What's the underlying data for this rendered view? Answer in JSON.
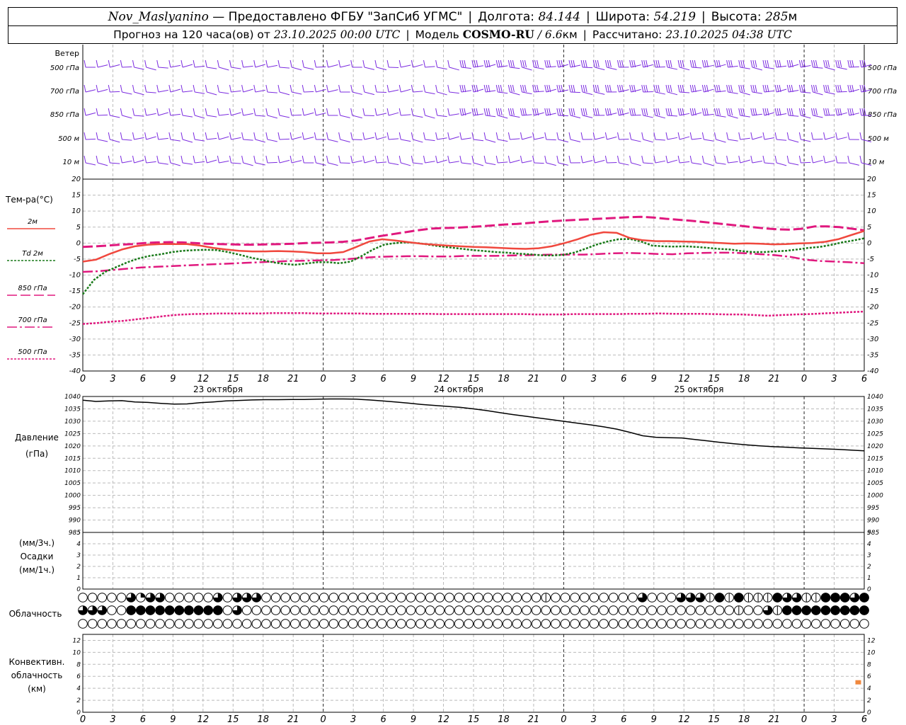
{
  "header": {
    "station": "Nov_Maslyanino",
    "provider": "— Предоставлено ФГБУ \"ЗапСиб УГМС\"",
    "lon_label": "Долгота:",
    "lon": "84.144",
    "lat_label": "Широта:",
    "lat": "54.219",
    "alt_label": "Высота:",
    "alt": "285",
    "alt_unit": "м",
    "forecast_label": "Прогноз на 120 часа(ов) от",
    "forecast_from": "23.10.2025 00:00 UTC",
    "model_label": "Модель",
    "model": "COSMO-RU",
    "model_res": "/ 6.6",
    "model_res_unit": "км",
    "calc_label": "Рассчитано:",
    "calc_time": "23.10.2025 04:38 UTC"
  },
  "chart_data": {
    "x_hours": [
      "0",
      "3",
      "6",
      "9",
      "12",
      "15",
      "18",
      "21",
      "0",
      "3",
      "6",
      "9",
      "12",
      "15",
      "18",
      "21",
      "0",
      "3",
      "6",
      "9",
      "12",
      "15",
      "18",
      "21",
      "0",
      "3",
      "6"
    ],
    "day_labels": [
      {
        "step": 4.5,
        "label": "23 октября"
      },
      {
        "step": 12.5,
        "label": "24 октября"
      },
      {
        "step": 20.5,
        "label": "25 октября"
      }
    ],
    "midnight_steps": [
      0,
      8,
      16,
      24
    ],
    "wind": {
      "panel_label": "Ветер",
      "levels": [
        "500 гПа",
        "700 гПа",
        "850 гПа",
        "500 м",
        "10  м"
      ],
      "color": "#7b2be0"
    },
    "temperature": {
      "panel_label": "Тем-ра(°C)",
      "ylim": [
        -40,
        20
      ],
      "yticks": [
        20,
        15,
        10,
        5,
        0,
        -5,
        -10,
        -15,
        -20,
        -25,
        -30,
        -35,
        -40
      ],
      "series": [
        {
          "name": "2м",
          "color": "#f0483e",
          "dash": "",
          "width": 2.5,
          "values": [
            -5.8,
            -5.2,
            -3.5,
            -2.0,
            -1.0,
            -0.5,
            -0.3,
            -0.3,
            -0.3,
            -0.8,
            -1.5,
            -2.0,
            -2.4,
            -2.6,
            -2.6,
            -2.5,
            -2.6,
            -2.8,
            -3.2,
            -3.2,
            -2.8,
            -1.2,
            0.5,
            1.2,
            0.8,
            0.3,
            -0.2,
            -0.5,
            -0.8,
            -1.0,
            -1.2,
            -1.3,
            -1.5,
            -1.7,
            -1.8,
            -1.6,
            -1.0,
            0.0,
            1.2,
            2.6,
            3.4,
            3.2,
            1.6,
            0.9,
            0.6,
            0.6,
            0.5,
            0.4,
            0.2,
            0.0,
            -0.2,
            -0.1,
            -0.2,
            -0.4,
            -0.3,
            -0.1,
            0.0,
            0.4,
            1.2,
            2.5,
            3.8
          ]
        },
        {
          "name": "Td  2м",
          "color": "#1a7a1a",
          "dash": "3,2",
          "width": 2.5,
          "values": [
            -16.0,
            -11.5,
            -9.0,
            -7.5,
            -6.0,
            -4.8,
            -4.0,
            -3.5,
            -2.8,
            -2.4,
            -2.2,
            -2.1,
            -2.2,
            -2.8,
            -3.6,
            -4.5,
            -5.2,
            -6.0,
            -6.5,
            -6.8,
            -6.4,
            -6.0,
            -6.0,
            -6.3,
            -5.8,
            -4.0,
            -2.0,
            -0.5,
            0.0,
            0.2,
            0.0,
            -0.5,
            -1.0,
            -1.4,
            -1.8,
            -2.2,
            -2.5,
            -2.8,
            -3.0,
            -3.3,
            -3.5,
            -3.8,
            -3.9,
            -3.7,
            -3.0,
            -1.8,
            -0.5,
            0.5,
            1.2,
            1.3,
            0.5,
            -0.8,
            -1.0,
            -1.1,
            -1.0,
            -1.2,
            -1.5,
            -1.8,
            -2.0,
            -2.5,
            -2.8,
            -2.8,
            -2.6,
            -2.4,
            -2.0,
            -1.5,
            -1.2,
            -0.6,
            0.2,
            0.8,
            1.5
          ]
        },
        {
          "name": "850 гПа",
          "color": "#e0187e",
          "dash": "14,5",
          "width": 3,
          "values": [
            -1.2,
            -1.0,
            -0.8,
            -0.5,
            -0.3,
            0.0,
            0.2,
            0.3,
            0.2,
            0.0,
            -0.2,
            -0.3,
            -0.4,
            -0.5,
            -0.5,
            -0.4,
            -0.3,
            -0.2,
            0.0,
            0.1,
            0.2,
            0.4,
            0.8,
            1.5,
            2.2,
            2.8,
            3.4,
            4.0,
            4.5,
            4.7,
            4.8,
            5.0,
            5.2,
            5.5,
            5.8,
            6.0,
            6.3,
            6.6,
            6.9,
            7.1,
            7.3,
            7.5,
            7.7,
            7.9,
            8.1,
            8.2,
            8.0,
            7.6,
            7.3,
            7.0,
            6.6,
            6.2,
            5.8,
            5.4,
            5.0,
            4.6,
            4.3,
            4.2,
            4.5,
            5.2,
            5.2,
            5.0,
            4.5,
            4.0
          ]
        },
        {
          "name": "700 гПа",
          "color": "#e0187e",
          "dash": "14,4,3,4",
          "width": 2.5,
          "values": [
            -9.0,
            -8.8,
            -8.4,
            -8.0,
            -7.6,
            -7.4,
            -7.2,
            -7.0,
            -6.8,
            -6.6,
            -6.4,
            -6.2,
            -6.0,
            -5.8,
            -5.6,
            -5.5,
            -5.4,
            -5.3,
            -5.0,
            -4.6,
            -4.3,
            -4.2,
            -4.1,
            -4.1,
            -4.2,
            -4.2,
            -4.0,
            -4.0,
            -4.0,
            -3.9,
            -3.8,
            -3.7,
            -3.6,
            -3.6,
            -3.6,
            -3.4,
            -3.2,
            -3.1,
            -3.2,
            -3.4,
            -3.5,
            -3.2,
            -3.1,
            -3.0,
            -3.0,
            -3.2,
            -3.5,
            -3.8,
            -4.3,
            -5.2,
            -5.6,
            -5.8,
            -6.0,
            -6.3
          ]
        },
        {
          "name": "500 гПа",
          "color": "#e0187e",
          "dash": "3,2",
          "width": 2.5,
          "values": [
            -25.3,
            -25.0,
            -24.6,
            -24.3,
            -23.8,
            -23.3,
            -22.8,
            -22.4,
            -22.2,
            -22.1,
            -22.0,
            -22.0,
            -22.0,
            -22.0,
            -21.9,
            -21.9,
            -21.9,
            -22.0,
            -22.0,
            -22.0,
            -22.0,
            -22.1,
            -22.1,
            -22.1,
            -22.1,
            -22.1,
            -22.2,
            -22.2,
            -22.2,
            -22.2,
            -22.2,
            -22.2,
            -22.2,
            -22.3,
            -22.3,
            -22.3,
            -22.2,
            -22.2,
            -22.2,
            -22.2,
            -22.1,
            -22.1,
            -22.0,
            -22.1,
            -22.1,
            -22.1,
            -22.2,
            -22.3,
            -22.3,
            -22.5,
            -22.7,
            -22.5,
            -22.3,
            -22.2,
            -22.0,
            -21.8,
            -21.6,
            -21.4
          ]
        }
      ]
    },
    "pressure": {
      "panel_label_1": "Давление",
      "panel_label_2": "(гПа)",
      "ylim": [
        985,
        1040
      ],
      "yticks": [
        1040,
        1035,
        1030,
        1025,
        1020,
        1015,
        1010,
        1005,
        1000,
        995,
        990,
        985
      ],
      "series": [
        {
          "name": "",
          "color": "#000000",
          "values": [
            1038.5,
            1038.0,
            1038.2,
            1038.3,
            1037.8,
            1037.6,
            1037.2,
            1036.9,
            1037.0,
            1037.5,
            1037.8,
            1038.2,
            1038.4,
            1038.6,
            1038.7,
            1038.7,
            1038.8,
            1038.8,
            1038.9,
            1039.0,
            1039.0,
            1038.9,
            1038.6,
            1038.2,
            1037.8,
            1037.3,
            1036.8,
            1036.4,
            1036.0,
            1035.6,
            1035.0,
            1034.3,
            1033.5,
            1032.7,
            1032.0,
            1031.3,
            1030.6,
            1029.9,
            1029.2,
            1028.5,
            1027.7,
            1026.8,
            1025.5,
            1024.1,
            1023.5,
            1023.3,
            1023.2,
            1022.6,
            1022.0,
            1021.4,
            1020.9,
            1020.4,
            1020.0,
            1019.7,
            1019.5,
            1019.2,
            1019.0,
            1018.8,
            1018.6,
            1018.3,
            1018.0
          ]
        }
      ]
    },
    "precipitation": {
      "panel_label_1": "(мм/3ч.)",
      "panel_label_2": "Осадки",
      "panel_label_3": "(мм/1ч.)",
      "ylim": [
        0,
        5
      ],
      "yticks": [
        5,
        4,
        3,
        2,
        1,
        0
      ],
      "values_note": "no precipitation shown"
    },
    "cloudiness": {
      "panel_label": "Облачность",
      "rows": [
        "0000031330000030333000000000000000000000000000002000000000300033324242224332244434",
        "3330044444444440300000000000000000000000000000000000000000000000000020032444444444",
        "0000000000000000000000000000000000000000000000000000000000000000000000000000000000"
      ]
    },
    "convective": {
      "panel_label_1": "Конвективн.",
      "panel_label_2": "облачность",
      "panel_label_3": "(км)",
      "ylim": [
        0,
        13
      ],
      "yticks": [
        12,
        10,
        8,
        6,
        4,
        2,
        0
      ],
      "points": [
        {
          "step": 25.8,
          "value": 5.0
        }
      ],
      "color": "#f0883e"
    }
  }
}
